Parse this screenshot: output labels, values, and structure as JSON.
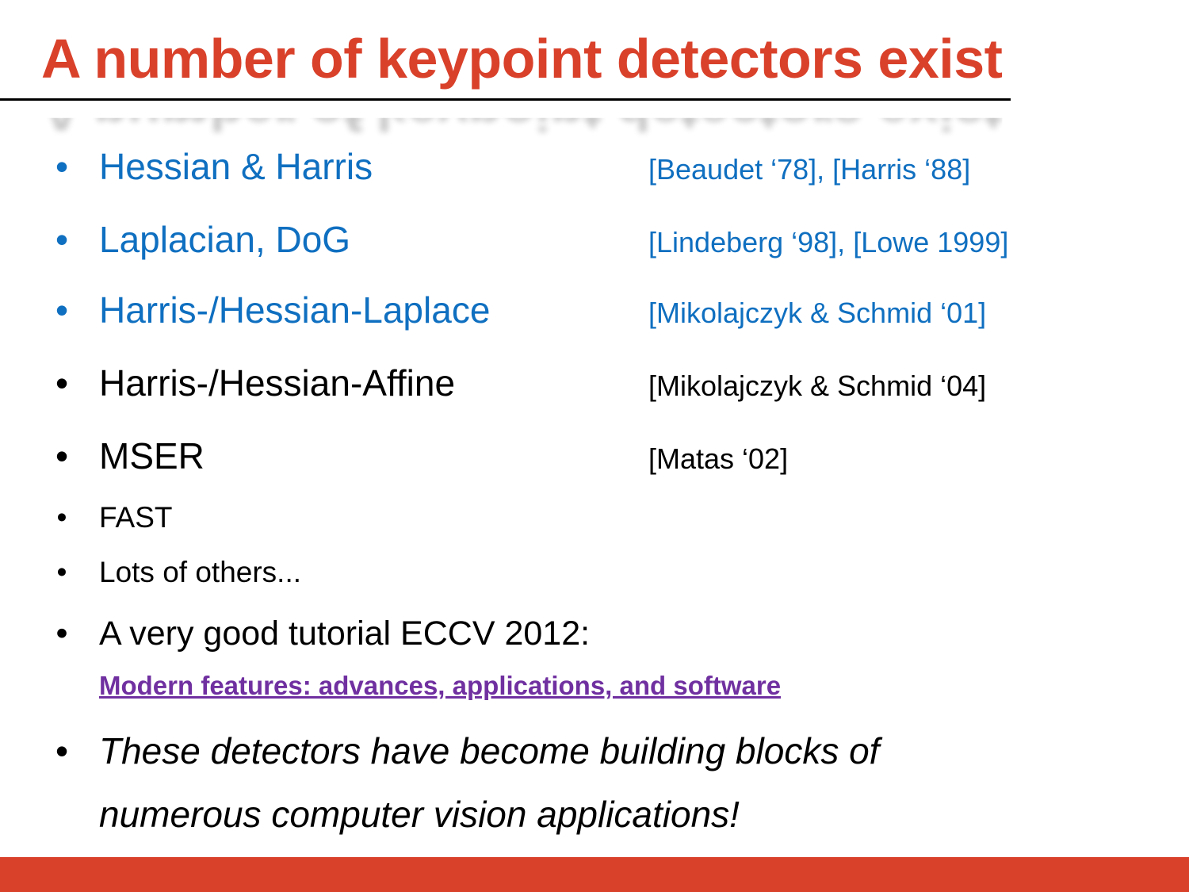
{
  "colors": {
    "accent": "#d9412b",
    "link_blue": "#0f6fc0",
    "text": "#000000",
    "visited_link": "#7030a0"
  },
  "slide": {
    "title": "A number of keypoint detectors exist",
    "bullet_glyph": "•",
    "items": [
      {
        "label": "Hessian & Harris",
        "ref": "[Beaudet ‘78], [Harris ‘88]"
      },
      {
        "label": "Laplacian, DoG",
        "ref": "[Lindeberg ‘98], [Lowe 1999]"
      },
      {
        "label": "Harris-/Hessian-Laplace",
        "ref": "[Mikolajczyk & Schmid ‘01]"
      },
      {
        "label": "Harris-/Hessian-Affine",
        "ref": "[Mikolajczyk & Schmid ‘04]"
      },
      {
        "label": "MSER",
        "ref": "[Matas ‘02]"
      },
      {
        "label": "FAST"
      },
      {
        "label": "Lots of others..."
      },
      {
        "label": "A very good tutorial ECCV 2012:"
      },
      {
        "label": "These detectors have become building blocks of"
      }
    ],
    "tutorial_link": "Modern features: advances, applications, and software",
    "closing_line2": "numerous computer vision applications!"
  }
}
